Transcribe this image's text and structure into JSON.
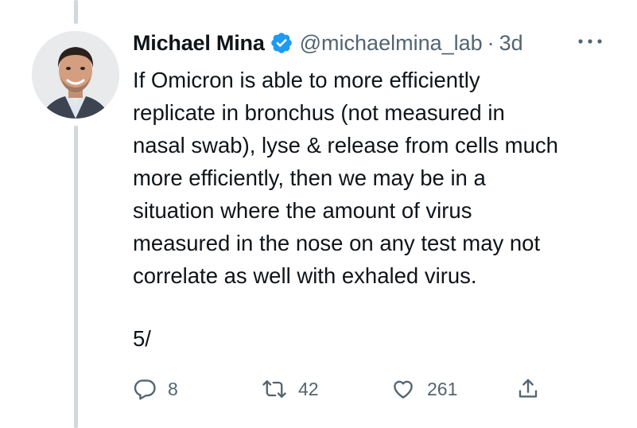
{
  "tweet": {
    "display_name": "Michael Mina",
    "handle": "@michaelmina_lab",
    "separator": "·",
    "time": "3d",
    "text": "If Omicron is able to more efficiently\nreplicate in bronchus (not measured in\nnasal swab), lyse & release from cells much\nmore efficiently, then we may be in a\nsituation where the amount of virus\nmeasured in the nose on any test may not\ncorrelate as well with exhaled virus.",
    "thread_number": "5/",
    "verified": true
  },
  "actions": {
    "replies": "8",
    "retweets": "42",
    "likes": "261"
  },
  "icons": {
    "reply": "reply-icon",
    "retweet": "retweet-icon",
    "like": "heart-icon",
    "share": "share-icon",
    "more": "more-icon",
    "verified": "verified-badge-icon"
  },
  "colors": {
    "text": "#0f1419",
    "secondary": "#536471",
    "verified": "#1d9bf0",
    "thread_line": "#cfd9de"
  }
}
